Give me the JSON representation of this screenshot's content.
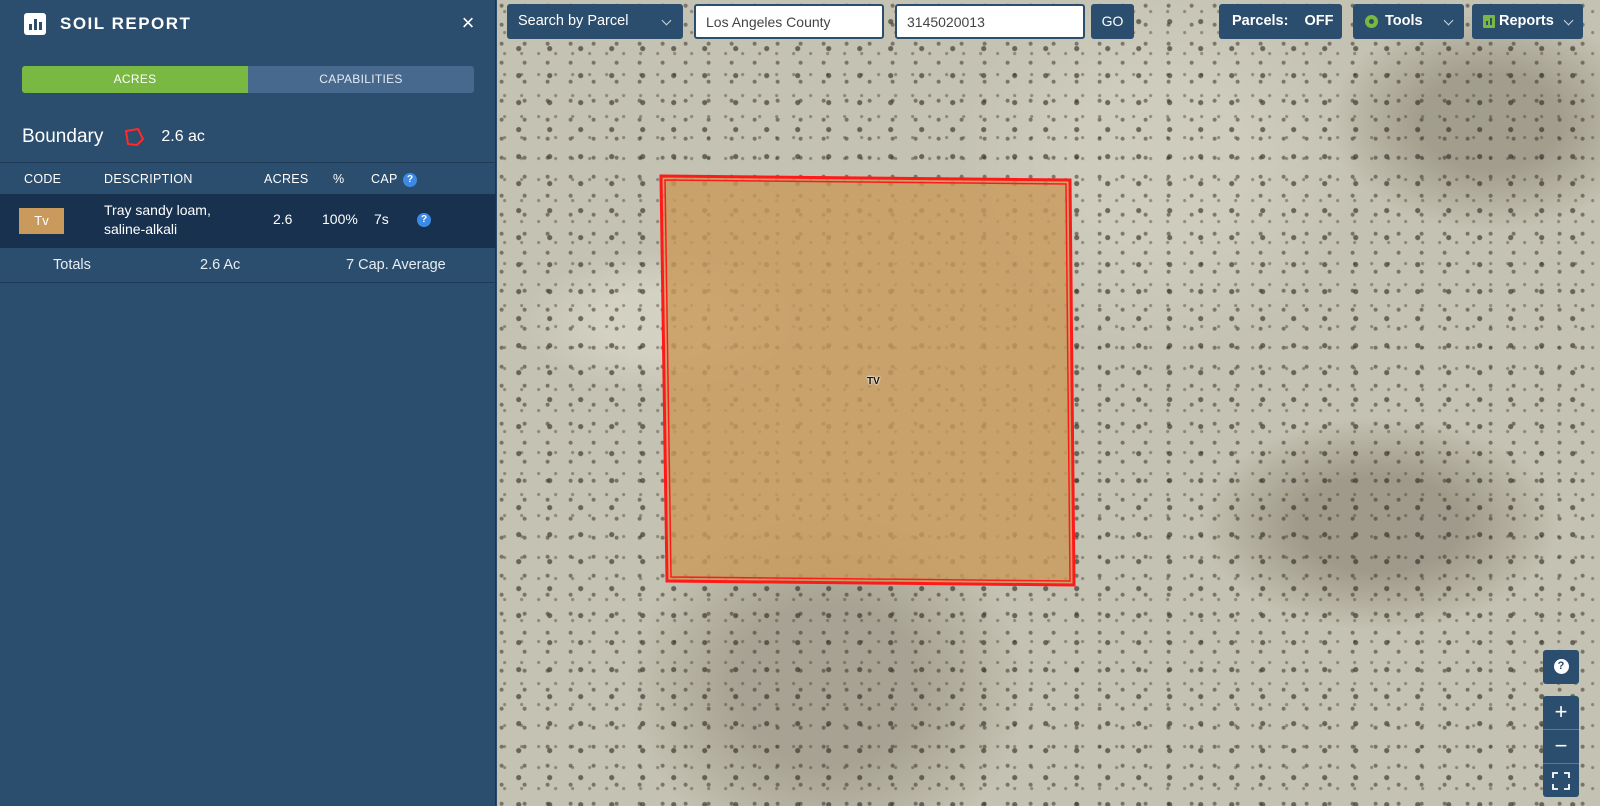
{
  "sidebar": {
    "title": "SOIL REPORT",
    "close_label": "×",
    "tabs": [
      {
        "label": "ACRES",
        "active": true
      },
      {
        "label": "CAPABILITIES",
        "active": false
      }
    ],
    "boundary": {
      "label": "Boundary",
      "value": "2.6 ac",
      "icon": "boundary-polygon-icon"
    },
    "table": {
      "headers": {
        "code": "CODE",
        "description": "DESCRIPTION",
        "acres": "ACRES",
        "percent": "%",
        "cap": "CAP"
      },
      "rows": [
        {
          "code": "Tv",
          "description": "Tray sandy loam, saline-alkali",
          "acres": "2.6",
          "percent": "100%",
          "cap": "7s",
          "swatch_color": "#c99a5c"
        }
      ],
      "totals": {
        "label": "Totals",
        "acres": "2.6 Ac",
        "cap": "7 Cap. Average"
      }
    }
  },
  "toolbar": {
    "search_mode": "Search by Parcel",
    "county_value": "Los Angeles County",
    "parcel_value": "3145020013",
    "go_label": "GO",
    "parcels_label": "Parcels:",
    "parcels_state": "OFF",
    "tools_label": "Tools",
    "reports_label": "Reports"
  },
  "map": {
    "parcel_label": "TV",
    "zoom_in_label": "+",
    "zoom_out_label": "−",
    "help_label": "?"
  },
  "colors": {
    "sidebar_bg": "#2b4d6e",
    "accent_green": "#79b943",
    "parcel_outline": "#ff1a1a",
    "soil_fill": "#c99a5c"
  }
}
